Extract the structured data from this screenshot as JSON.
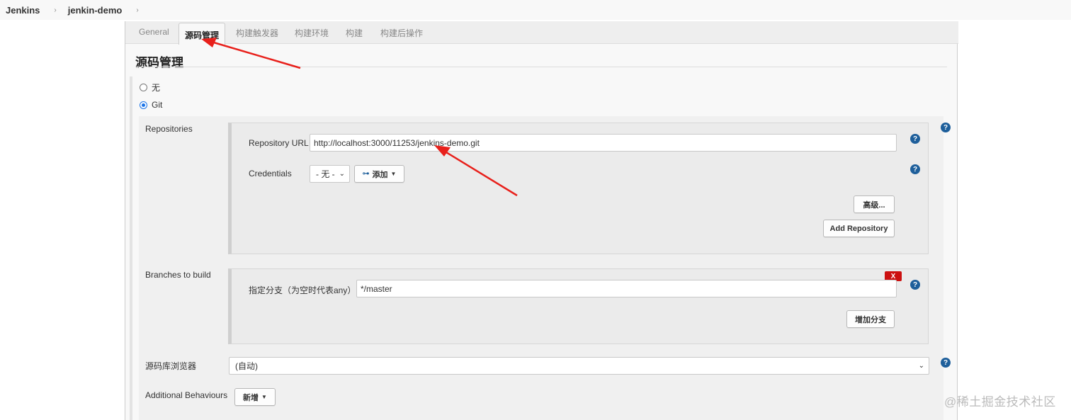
{
  "breadcrumb": {
    "items": [
      "Jenkins",
      "jenkin-demo"
    ]
  },
  "tabs": [
    "General",
    "源码管理",
    "构建触发器",
    "构建环境",
    "构建",
    "构建后操作"
  ],
  "active_tab": "源码管理",
  "section": {
    "title": "源码管理"
  },
  "scm_options": [
    {
      "label": "无",
      "checked": false
    },
    {
      "label": "Git",
      "checked": true
    }
  ],
  "repositories": {
    "label": "Repositories",
    "url_label": "Repository URL",
    "url_value": "http://localhost:3000/11253/jenkins-demo.git",
    "credentials_label": "Credentials",
    "credentials_value": "- 无 -",
    "add_label": "添加",
    "advanced_label": "高级...",
    "add_repo_label": "Add Repository"
  },
  "branches": {
    "label": "Branches to build",
    "spec_label": "指定分支（为空时代表any）",
    "spec_value": "*/master",
    "delete_label": "X",
    "add_branch_label": "增加分支"
  },
  "browser": {
    "label": "源码库浏览器",
    "value": "(自动)"
  },
  "behaviours": {
    "label": "Additional Behaviours",
    "add_label": "新增"
  },
  "help_glyph": "?",
  "watermark": "@稀土掘金技术社区",
  "colors": {
    "annotation_red": "#e8201b",
    "help_blue": "#1e5f9b",
    "delete_red": "#cc1111"
  }
}
